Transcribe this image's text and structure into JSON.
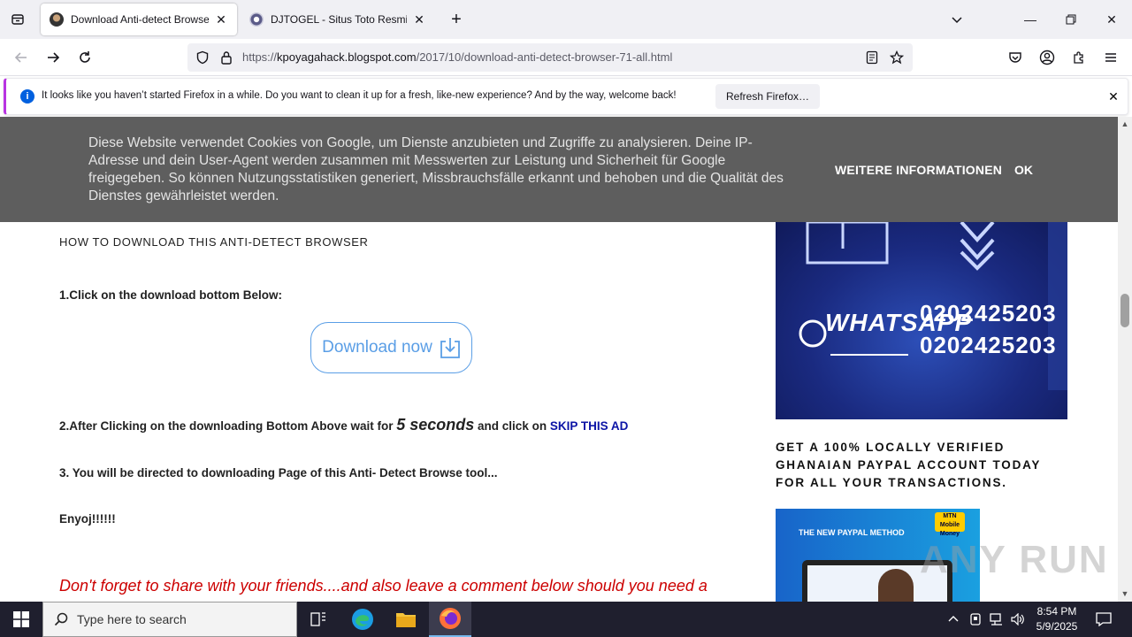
{
  "browser": {
    "tabs": [
      {
        "title": "Download Anti-detect Browser",
        "active": true
      },
      {
        "title": "DJTOGEL - Situs Toto Resmi Terg",
        "active": false
      }
    ],
    "url": {
      "scheme": "https://",
      "host": "kpoyagahack.blogspot.com",
      "path": "/2017/10/download-anti-detect-browser-71-all.html"
    },
    "notification": {
      "text": "It looks like you haven’t started Firefox in a while. Do you want to clean it up for a fresh, like-new experience? And by the way, welcome back!",
      "button": "Refresh Firefox…"
    }
  },
  "cookie_banner": {
    "text": "Diese Website verwendet Cookies von Google, um Dienste anzubieten und Zugriffe zu analysieren. Deine IP-Adresse und dein User-Agent werden zusammen mit Messwerten zur Leistung und Sicherheit für Google freigegeben. So können Nutzungsstatistiken generiert, Missbrauchsfälle erkannt und behoben und die Qualität des Dienstes gewährleistet werden.",
    "more": "WEITERE INFORMATIONEN",
    "ok": "OK"
  },
  "post": {
    "heading": "HOW TO DOWNLOAD THIS ANTI-DETECT BROWSER",
    "step1": "1.Click on the download bottom Below:",
    "download_button": "Download now",
    "step2_a": "2.After Clicking on the downloading Bottom Above wait for ",
    "step2_b": "5 seconds",
    "step2_c": " and click on ",
    "step2_d": "SKIP THIS AD",
    "step3": "3. You will be directed to downloading Page of this Anti- Detect Browse tool...",
    "enjoy": "Enyoj!!!!!!",
    "share": "Don't forget to share with your friends....and also leave a comment below should you need a"
  },
  "sidebar": {
    "whatsapp_label": "WHATSAPP",
    "whatsapp_numbers": [
      "0202425203",
      "0202425203"
    ],
    "promo": "GET A 100% LOCALLY VERIFIED GHANAIAN PAYPAL ACCOUNT TODAY FOR ALL YOUR TRANSACTIONS.",
    "paypal_image_title": "THE NEW PAYPAL METHOD",
    "mtn_badge": "MTN Mobile Money"
  },
  "watermark": "ANY RUN",
  "taskbar": {
    "search_placeholder": "Type here to search",
    "time": "8:54 PM",
    "date": "5/9/2025"
  },
  "colors": {
    "accent": "#0060df",
    "notice_border": "#b833e1",
    "skip_link": "#0c14a6",
    "share_text": "#cc0000",
    "download_btn": "#5a9ee6"
  }
}
